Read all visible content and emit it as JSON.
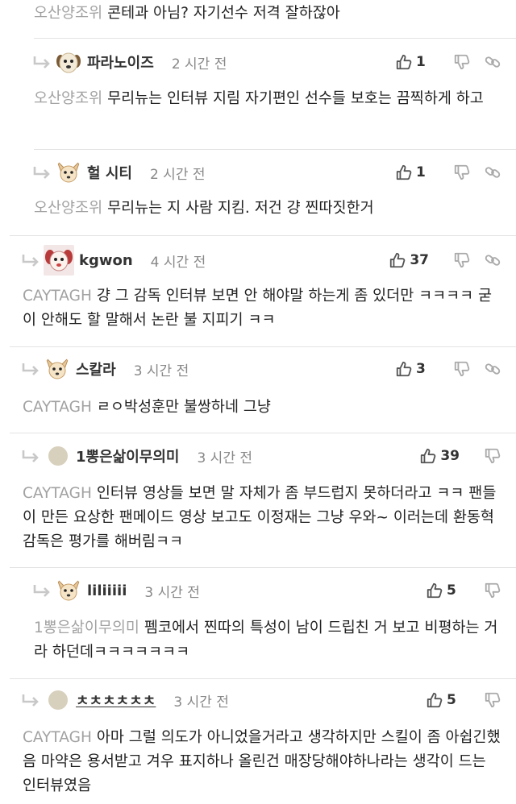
{
  "comments": [
    {
      "tag": "오산양조위",
      "text": "콘테과 아님? 자기선수 저격 잘하잖아"
    },
    {
      "nick": "파라노이즈",
      "time": "2 시간 전",
      "likes": "1",
      "avatar_icon": "dog-face-icon",
      "tag": "오산양조위",
      "text": "무리뉴는 인터뷰 지림 자기편인 선수들 보호는 끔찍하게 하고"
    },
    {
      "nick": "헐 시티",
      "time": "2 시간 전",
      "likes": "1",
      "avatar_icon": "chihuahua-icon",
      "tag": "오산양조위",
      "text": "무리뉴는 지 사람 지킴. 저건 걍 찐따짓한거"
    },
    {
      "nick": "kgwon",
      "time": "4 시간 전",
      "likes": "37",
      "avatar_icon": "pink-puppy-icon",
      "tag": "CAYTAGH",
      "text": "걍 그 감독 인터뷰 보면 안 해야말 하는게 좀 있더만 ㅋㅋㅋㅋ 굳이 안해도 할 말해서 논란 불 지피기 ㅋㅋ"
    },
    {
      "nick": "스칼라",
      "time": "3 시간 전",
      "likes": "3",
      "avatar_icon": "chihuahua-icon",
      "tag": "CAYTAGH",
      "text": "ㄹㅇ박성훈만 불쌍하네 그냥"
    },
    {
      "nick": "1뽕은삶이무의미",
      "time": "3 시간 전",
      "likes": "39",
      "avatar_icon": "default-avatar-icon",
      "tag": "CAYTAGH",
      "text": "인터뷰 영상들 보면 말 자체가 좀 부드럽지 못하더라고 ㅋㅋ 팬들이 만든 요상한 팬메이드 영상 보고도 이정재는 그냥 우와~ 이러는데 환동혁 감독은 평가를 해버림ㅋㅋ"
    },
    {
      "nick": "liliiiii",
      "time": "3 시간 전",
      "likes": "5",
      "avatar_icon": "chihuahua-icon",
      "tag": "1뽕은삶이무의미",
      "text": "펨코에서 찐따의 특성이 남이 드립친 거 보고 비평하는 거라 하던데ㅋㅋㅋㅋㅋㅋㅋ"
    },
    {
      "nick": "ㅊㅊㅊㅊㅊㅊ",
      "time": "3 시간 전",
      "likes": "5",
      "avatar_icon": "default-avatar-icon",
      "tag": "CAYTAGH",
      "text": "아마 그럴 의도가 아니었을거라고 생각하지만 스킬이 좀 아쉽긴했음 마약은 용서받고 겨우 표지하나 올린건 매장당해야하나라는 생각이 드는 인터뷰였음"
    }
  ],
  "colors": {
    "tag": "#a2a2a2",
    "divider": "#e3e3e3",
    "icon": "#666666"
  }
}
